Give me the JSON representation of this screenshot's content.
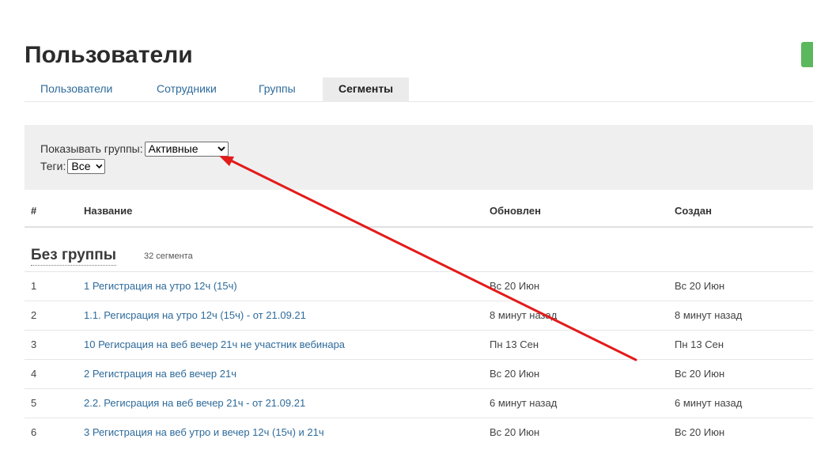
{
  "page": {
    "title": "Пользователи"
  },
  "tabs": [
    {
      "label": "Пользователи",
      "active": false
    },
    {
      "label": "Сотрудники",
      "active": false
    },
    {
      "label": "Группы",
      "active": false
    },
    {
      "label": "Сегменты",
      "active": true
    }
  ],
  "filters": {
    "groups_label": "Показывать группы:",
    "groups_value": "Активные",
    "tags_label": "Теги:",
    "tags_value": "Все"
  },
  "table": {
    "columns": [
      "#",
      "Название",
      "Обновлен",
      "Создан"
    ],
    "group": {
      "title": "Без группы",
      "count": "32 сегмента"
    },
    "rows": [
      {
        "num": "1",
        "name": "1 Регистрация на утро 12ч (15ч)",
        "updated": "Вс 20 Июн",
        "created": "Вс 20 Июн"
      },
      {
        "num": "2",
        "name": "1.1. Регисрация на утро 12ч (15ч) - от 21.09.21",
        "updated": "8 минут назад",
        "created": "8 минут назад"
      },
      {
        "num": "3",
        "name": "10 Регисрация на веб вечер 21ч не участник вебинара",
        "updated": "Пн 13 Сен",
        "created": "Пн 13 Сен"
      },
      {
        "num": "4",
        "name": "2 Регистрация на веб вечер 21ч",
        "updated": "Вс 20 Июн",
        "created": "Вс 20 Июн"
      },
      {
        "num": "5",
        "name": "2.2. Регисрация на веб вечер 21ч - от 21.09.21",
        "updated": "6 минут назад",
        "created": "6 минут назад"
      },
      {
        "num": "6",
        "name": "3 Регистрация на веб утро и вечер 12ч (15ч) и 21ч",
        "updated": "Вс 20 Июн",
        "created": "Вс 20 Июн"
      }
    ]
  },
  "colors": {
    "link": "#2e6b9b",
    "accent_green": "#5cb85c",
    "annotation_arrow": "#e31b1b"
  },
  "icons": {
    "select_caret": "chevron-down-icon"
  }
}
